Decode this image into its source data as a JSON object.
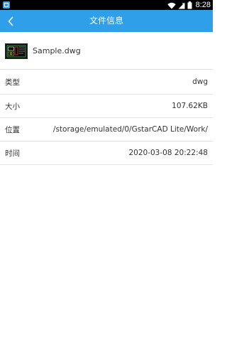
{
  "status_bar": {
    "time": "8:28",
    "icons": [
      "app-notification-icon",
      "wifi-icon",
      "signal-icon",
      "battery-icon"
    ]
  },
  "app_bar": {
    "title": "文件信息",
    "back_icon": "chevron-left-icon",
    "color": "#2e9fe8"
  },
  "file": {
    "name": "Sample.dwg",
    "thumbnail_icon": "dwg-thumbnail-icon"
  },
  "info": [
    {
      "label": "类型",
      "value": "dwg"
    },
    {
      "label": "大小",
      "value": "107.62KB"
    },
    {
      "label": "位置",
      "value": "/storage/emulated/0/GstarCAD Lite/Work/"
    },
    {
      "label": "时间",
      "value": "2020-03-08 20:22:48"
    }
  ]
}
